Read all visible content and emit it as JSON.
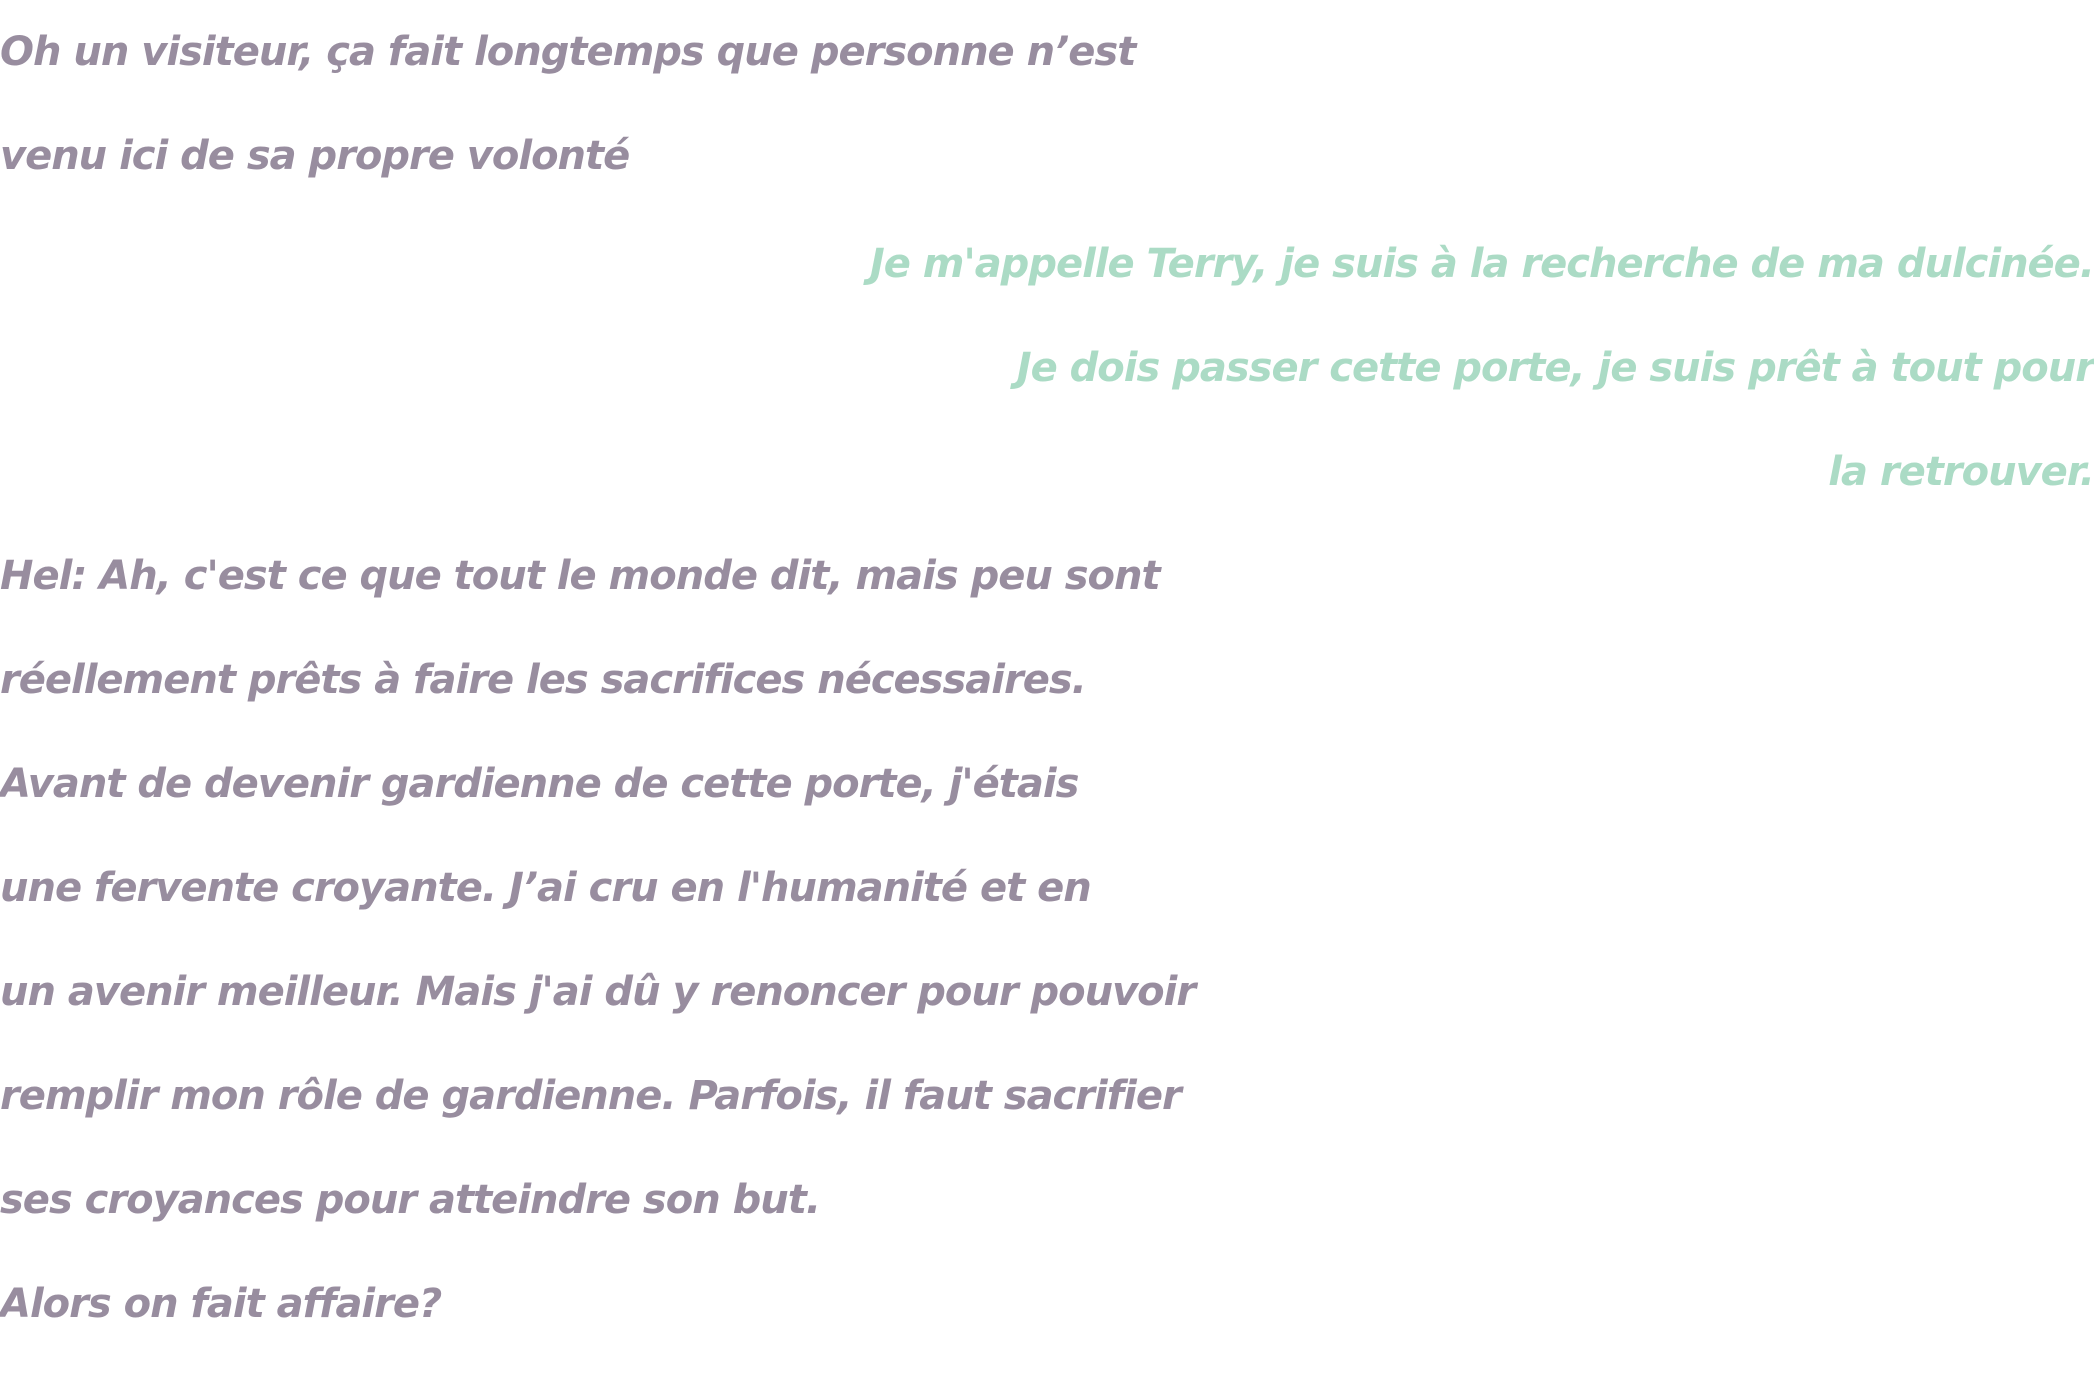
{
  "colors": {
    "npc_text": "#988d9f",
    "player_text": "#abdbc5",
    "background": "#ffffff"
  },
  "npc_intro": [
    "Oh un visiteur, ça fait longtemps que personne n’est",
    "venu ici de sa propre volonté"
  ],
  "player_reply": [
    "Je m'appelle Terry, je suis à la recherche de ma dulcinée.",
    "Je dois passer cette porte, je suis prêt à tout pour",
    "la retrouver."
  ],
  "npc_response": [
    "Hel: Ah, c'est ce que tout le monde dit, mais peu sont",
    "réellement prêts à faire les sacrifices nécessaires.",
    "Avant de devenir gardienne de cette porte, j'étais",
    "une fervente croyante. J’ai cru en l'humanité et en",
    "un avenir meilleur. Mais j'ai dû y renoncer pour pouvoir",
    "remplir mon rôle de gardienne. Parfois, il faut sacrifier",
    "ses croyances pour atteindre son but.",
    "Alors on fait affaire?"
  ]
}
